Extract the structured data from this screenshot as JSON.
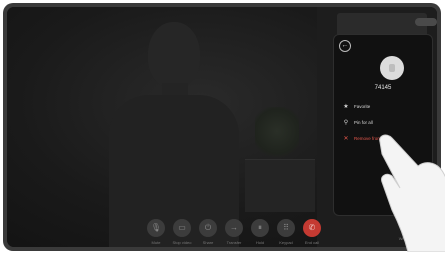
{
  "participant": {
    "name": "74145",
    "menu": [
      {
        "label": "Favorite",
        "icon": "star-icon",
        "glyph": "★"
      },
      {
        "label": "Pin for all",
        "icon": "pin-icon",
        "glyph": "⚲"
      },
      {
        "label": "Remove from call",
        "icon": "close-icon",
        "glyph": "✕"
      }
    ]
  },
  "controls": [
    {
      "label": "Mute",
      "icon": "microphone-icon",
      "glyph": "🎙"
    },
    {
      "label": "Stop video",
      "icon": "camera-icon",
      "glyph": "▭"
    },
    {
      "label": "Share",
      "icon": "share-icon",
      "glyph": "⏻"
    },
    {
      "label": "Transfer",
      "icon": "transfer-icon",
      "glyph": "→"
    },
    {
      "label": "Hold",
      "icon": "pause-icon",
      "glyph": "⏸"
    },
    {
      "label": "Keypad",
      "icon": "keypad-icon",
      "glyph": "⠿"
    },
    {
      "label": "End call",
      "icon": "end-call-icon",
      "glyph": "✆"
    }
  ],
  "right_control": {
    "label": "Whiteboard",
    "icon": "whiteboard-icon",
    "glyph": "▦"
  },
  "colors": {
    "end_call": "#c43a32",
    "danger": "#e4574c",
    "panel_bg": "#111111"
  }
}
